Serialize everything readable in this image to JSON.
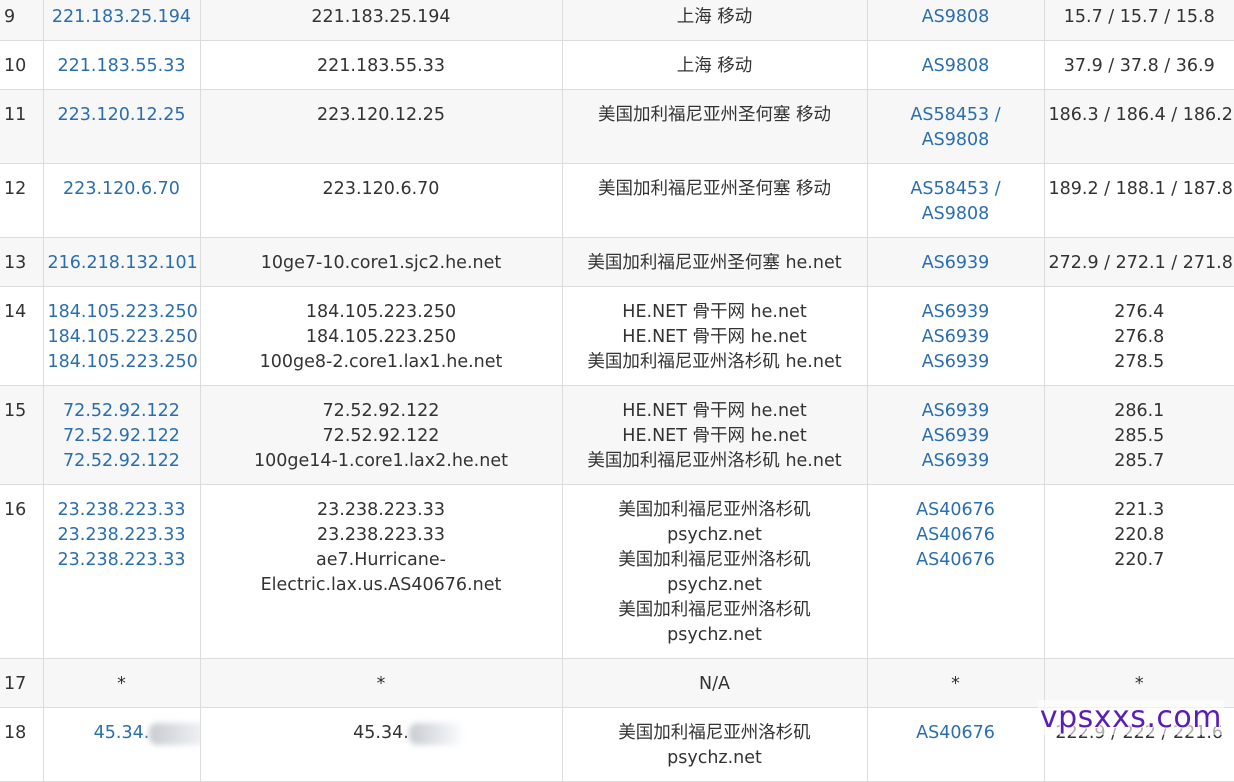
{
  "rows": [
    {
      "hop": "9",
      "ips": [
        "221.183.25.194"
      ],
      "hosts": [
        "221.183.25.194"
      ],
      "locations": [
        "上海 移动"
      ],
      "as": [
        "AS9808"
      ],
      "latencies": [
        "15.7 / 15.7 / 15.8"
      ]
    },
    {
      "hop": "10",
      "ips": [
        "221.183.55.33"
      ],
      "hosts": [
        "221.183.55.33"
      ],
      "locations": [
        "上海 移动"
      ],
      "as": [
        "AS9808"
      ],
      "latencies": [
        "37.9 / 37.8 / 36.9"
      ]
    },
    {
      "hop": "11",
      "ips": [
        "223.120.12.25"
      ],
      "hosts": [
        "223.120.12.25"
      ],
      "locations": [
        "美国加利福尼亚州圣何塞 移动"
      ],
      "as": [
        "AS58453 /",
        "AS9808"
      ],
      "latencies": [
        "186.3 / 186.4 / 186.2"
      ]
    },
    {
      "hop": "12",
      "ips": [
        "223.120.6.70"
      ],
      "hosts": [
        "223.120.6.70"
      ],
      "locations": [
        "美国加利福尼亚州圣何塞 移动"
      ],
      "as": [
        "AS58453 /",
        "AS9808"
      ],
      "latencies": [
        "189.2 / 188.1 / 187.8"
      ]
    },
    {
      "hop": "13",
      "ips": [
        "216.218.132.101"
      ],
      "hosts": [
        "10ge7-10.core1.sjc2.he.net"
      ],
      "locations": [
        "美国加利福尼亚州圣何塞 he.net"
      ],
      "as": [
        "AS6939"
      ],
      "latencies": [
        "272.9 / 272.1 / 271.8"
      ]
    },
    {
      "hop": "14",
      "ips": [
        "184.105.223.250",
        "184.105.223.250",
        "184.105.223.250"
      ],
      "hosts": [
        "184.105.223.250",
        "184.105.223.250",
        "100ge8-2.core1.lax1.he.net"
      ],
      "locations": [
        "HE.NET 骨干网 he.net",
        "HE.NET 骨干网 he.net",
        "美国加利福尼亚州洛杉矶 he.net"
      ],
      "as": [
        "AS6939",
        "AS6939",
        "AS6939"
      ],
      "latencies": [
        "276.4",
        "276.8",
        "278.5"
      ]
    },
    {
      "hop": "15",
      "ips": [
        "72.52.92.122",
        "72.52.92.122",
        "72.52.92.122"
      ],
      "hosts": [
        "72.52.92.122",
        "72.52.92.122",
        "100ge14-1.core1.lax2.he.net"
      ],
      "locations": [
        "HE.NET 骨干网 he.net",
        "HE.NET 骨干网 he.net",
        "美国加利福尼亚州洛杉矶 he.net"
      ],
      "as": [
        "AS6939",
        "AS6939",
        "AS6939"
      ],
      "latencies": [
        "286.1",
        "285.5",
        "285.7"
      ]
    },
    {
      "hop": "16",
      "ips": [
        "23.238.223.33",
        "23.238.223.33",
        "23.238.223.33"
      ],
      "hosts": [
        "23.238.223.33",
        "23.238.223.33",
        "ae7.Hurricane-",
        "Electric.lax.us.AS40676.net"
      ],
      "locations": [
        "美国加利福尼亚州洛杉矶",
        "psychz.net",
        "美国加利福尼亚州洛杉矶",
        "psychz.net",
        "美国加利福尼亚州洛杉矶",
        "psychz.net"
      ],
      "as": [
        "AS40676",
        "AS40676",
        "AS40676"
      ],
      "latencies": [
        "221.3",
        "220.8",
        "220.7"
      ]
    },
    {
      "hop": "17",
      "ips": [
        "*"
      ],
      "hosts": [
        "*"
      ],
      "locations": [
        "N/A"
      ],
      "as": [
        "*"
      ],
      "latencies": [
        "*"
      ]
    },
    {
      "hop": "18",
      "ips": [
        "45.34."
      ],
      "hosts": [
        "45.34."
      ],
      "locations": [
        "美国加利福尼亚州洛杉矶",
        "psychz.net"
      ],
      "as": [
        "AS40676"
      ],
      "latencies": [
        "222.9 / 222 / 221.6"
      ]
    }
  ],
  "watermark": "vpsxxs.com",
  "colors": {
    "link": "#2a6eb0",
    "border": "#dcdcdc",
    "alt_row": "#f7f7f7",
    "watermark": "#5a1eb5"
  }
}
